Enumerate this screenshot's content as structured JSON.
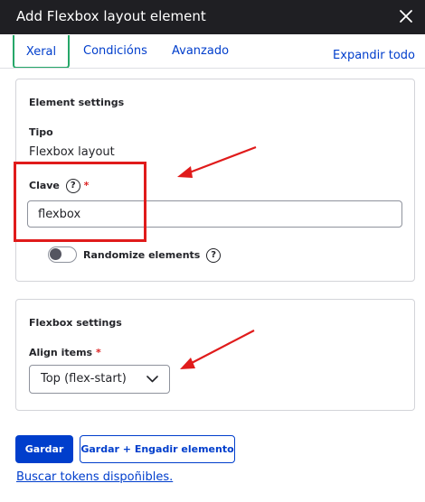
{
  "dialog": {
    "title": "Add Flexbox layout element",
    "close_icon": "close-icon"
  },
  "tabs": [
    {
      "label": "Xeral",
      "active": true
    },
    {
      "label": "Condicións",
      "active": false
    },
    {
      "label": "Avanzado",
      "active": false
    }
  ],
  "expand_all": "Expandir todo",
  "element_settings": {
    "title": "Element settings",
    "type_label": "Tipo",
    "type_value": "Flexbox layout",
    "key_label": "Clave",
    "key_help": "?",
    "key_required": "*",
    "key_value": "flexbox",
    "randomize_label": "Randomize elements",
    "randomize_help": "?",
    "randomize_enabled": false
  },
  "flexbox_settings": {
    "title": "Flexbox settings",
    "align_label": "Align items",
    "align_required": "*",
    "align_value": "Top (flex-start)"
  },
  "actions": {
    "save_label": "Gardar",
    "save_add_label": "Gardar + Engadir elemento",
    "tokens_link": "Buscar tokens dispoñibles."
  },
  "colors": {
    "accent": "#003ecc",
    "active_tab_border": "#26a769",
    "annotation_red": "#e01b1b",
    "titlebar": "#1f1f23"
  }
}
